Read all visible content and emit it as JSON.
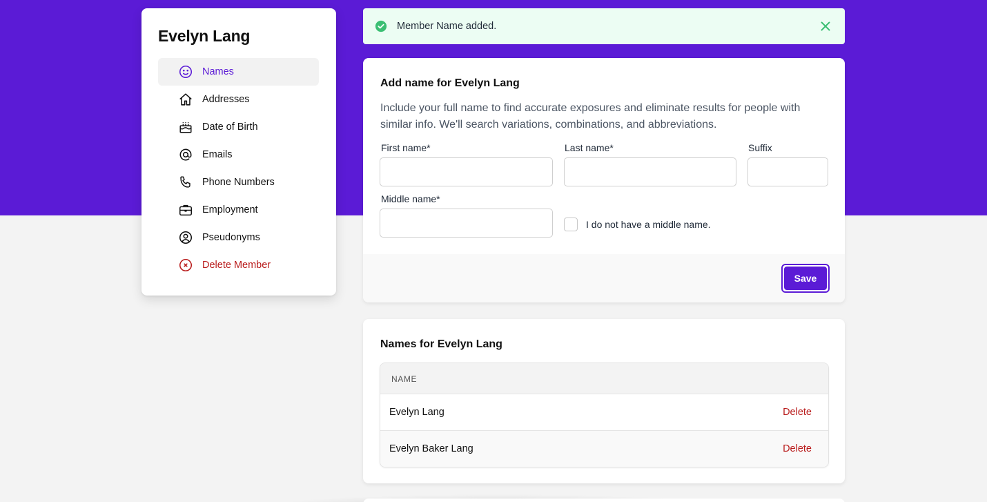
{
  "sidebar": {
    "title": "Evelyn Lang",
    "items": [
      {
        "label": "Names",
        "icon": "smile-icon"
      },
      {
        "label": "Addresses",
        "icon": "home-icon"
      },
      {
        "label": "Date of Birth",
        "icon": "cake-icon"
      },
      {
        "label": "Emails",
        "icon": "at-icon"
      },
      {
        "label": "Phone Numbers",
        "icon": "phone-icon"
      },
      {
        "label": "Employment",
        "icon": "briefcase-icon"
      },
      {
        "label": "Pseudonyms",
        "icon": "user-circle-icon"
      },
      {
        "label": "Delete Member",
        "icon": "x-circle-icon"
      }
    ]
  },
  "toast": {
    "message": "Member Name added."
  },
  "form": {
    "title": "Add name for Evelyn Lang",
    "description": "Include your full name to find accurate exposures and eliminate results for people with similar info. We'll search variations, combinations, and abbreviations.",
    "first_name_label": "First name*",
    "last_name_label": "Last name*",
    "suffix_label": "Suffix",
    "middle_name_label": "Middle name*",
    "no_middle_label": "I do not have a middle name.",
    "first_name_value": "",
    "last_name_value": "",
    "suffix_value": "",
    "middle_name_value": "",
    "save_label": "Save"
  },
  "names": {
    "title": "Names for Evelyn Lang",
    "column_header": "NAME",
    "rows": [
      {
        "name": "Evelyn Lang",
        "action": "Delete"
      },
      {
        "name": "Evelyn Baker Lang",
        "action": "Delete"
      }
    ]
  },
  "colors": {
    "brand": "#5b1bd6",
    "danger": "#b91c1c",
    "success": "#3bbf73"
  }
}
